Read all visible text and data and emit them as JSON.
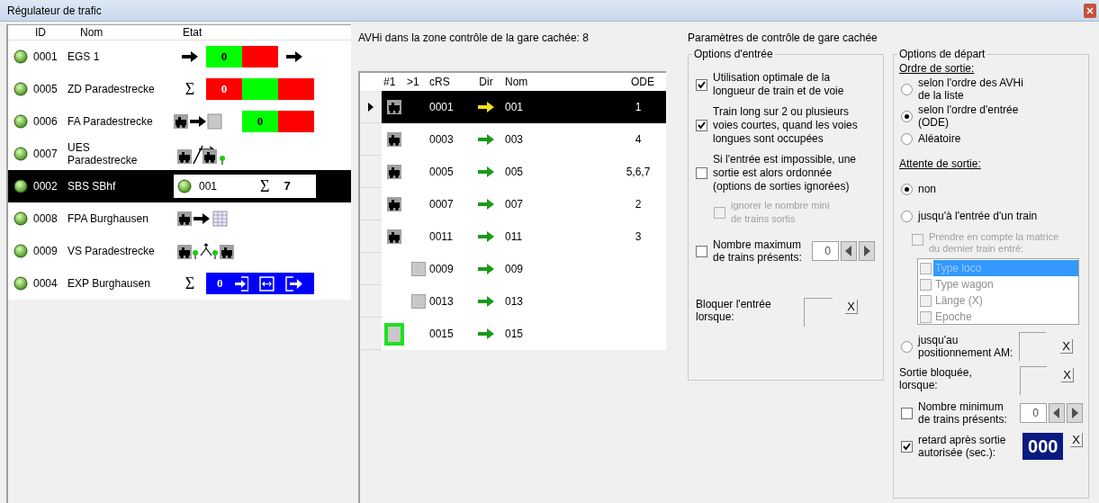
{
  "window": {
    "title": "Régulateur de trafic"
  },
  "list": {
    "columns": [
      "ID",
      "Nom",
      "Etat"
    ],
    "items": [
      {
        "id": "0001",
        "name": "EGS 1",
        "selected": false,
        "status": {
          "kind": "bar",
          "prefix": {
            "kind": "arrow"
          },
          "trail": {
            "kind": "arrow"
          },
          "segments": [
            {
              "color": "#00ff00",
              "text": "0"
            },
            {
              "color": "#ff0000"
            }
          ]
        }
      },
      {
        "id": "0005",
        "name": "ZD Paradestrecke",
        "selected": false,
        "status": {
          "kind": "bar",
          "prefix": {
            "kind": "sum",
            "symbol": "Σ"
          },
          "segments": [
            {
              "color": "#ff0000",
              "text": "0"
            },
            {
              "color": "#00ff00"
            },
            {
              "color": "#ff0000"
            }
          ]
        }
      },
      {
        "id": "0006",
        "name": "FA Paradestrecke",
        "selected": false,
        "status": {
          "kind": "bar",
          "prefix": {
            "kind": "train_to_slot"
          },
          "segments": [
            {
              "color": "#00ff00",
              "text": "0"
            },
            {
              "color": "#ff0000"
            }
          ]
        }
      },
      {
        "id": "0007",
        "name": "UES\nParadestrecke",
        "selected": false,
        "status": {
          "kind": "route"
        }
      },
      {
        "id": "0002",
        "name": "SBS SBhf",
        "selected": true,
        "status": {
          "kind": "station",
          "track": "001",
          "symbol": "Σ",
          "count": "7"
        }
      },
      {
        "id": "0008",
        "name": "FPA Burghausen",
        "selected": false,
        "status": {
          "kind": "train_to_table"
        }
      },
      {
        "id": "0009",
        "name": "VS Paradestrecke",
        "selected": false,
        "status": {
          "kind": "split"
        }
      },
      {
        "id": "0004",
        "name": "EXP Burghausen",
        "selected": false,
        "status": {
          "kind": "exit",
          "symbol": "Σ",
          "count": "0",
          "color": "#0000ff"
        }
      }
    ]
  },
  "trains": {
    "title": "AVHi dans la zone contrôle de la gare cachée: 8",
    "columns": [
      "#1",
      ">1",
      "cRS",
      "Dir",
      "Nom",
      "ODE"
    ],
    "rows": [
      {
        "crs": "0001",
        "nom": "001",
        "ode": "1",
        "selected": true,
        "marker": {
          "kind": "loco"
        }
      },
      {
        "crs": "0003",
        "nom": "003",
        "ode": "4",
        "selected": false,
        "marker": {
          "kind": "loco"
        }
      },
      {
        "crs": "0005",
        "nom": "005",
        "ode": "5,6,7",
        "selected": false,
        "marker": {
          "kind": "loco"
        }
      },
      {
        "crs": "0007",
        "nom": "007",
        "ode": "2",
        "selected": false,
        "marker": {
          "kind": "loco"
        }
      },
      {
        "crs": "0011",
        "nom": "011",
        "ode": "3",
        "selected": false,
        "marker": {
          "kind": "loco"
        }
      },
      {
        "crs": "0009",
        "nom": "009",
        "selected": false,
        "marker": {
          "kind": "slot"
        }
      },
      {
        "crs": "0013",
        "nom": "013",
        "selected": false,
        "marker": {
          "kind": "slot"
        }
      },
      {
        "crs": "0015",
        "nom": "015",
        "selected": false,
        "marker": {
          "kind": "slot_active"
        }
      }
    ]
  },
  "settings": {
    "title": "Paramètres de contrôle de gare cachée",
    "entry": {
      "title": "Options d'entrée",
      "options": [
        {
          "label": "Utilisation optimale de la\nlongueur de train et de voie",
          "checked": true,
          "disabled": false,
          "indented": false
        },
        {
          "label": "Train long sur 2 ou plusieurs\nvoies courtes, quand les voies\nlongues sont occupées",
          "checked": true,
          "disabled": false,
          "indented": false
        },
        {
          "label": "Si l'entrée est impossible, une\nsortie est alors ordonnée\n(options de sorties ignorées)",
          "checked": false,
          "disabled": false,
          "indented": false
        },
        {
          "label": "ignorer le nombre mini\nde trains sortis",
          "checked": false,
          "disabled": true,
          "indented": true
        }
      ],
      "max_trains": {
        "label": "Nombre maximum\nde trains présents:",
        "checked": false,
        "value": "0"
      },
      "block": {
        "label": "Bloquer l'entrée\nlorsque:",
        "clear": "X"
      }
    },
    "departure": {
      "title": "Options de départ",
      "order": {
        "title": "Ordre de sortie:",
        "options": [
          {
            "label": "selon l'ordre des AVHi\nde la liste",
            "selected": false
          },
          {
            "label": "selon l'ordre d'entrée\n(ODE)",
            "selected": true
          },
          {
            "label": "Aléatoire",
            "selected": false
          }
        ]
      },
      "wait": {
        "title": "Attente de sortie:",
        "options": [
          {
            "label": "non",
            "selected": true
          },
          {
            "label": "jusqu'à l'entrée d'un train",
            "selected": false
          },
          {
            "label": "jusqu'au\npositionnement AM:",
            "selected": false,
            "clear": "X"
          }
        ]
      },
      "matrix": {
        "label": "Prendre en compte la matrice\ndu dernier train entré:",
        "checked": false,
        "disabled": true,
        "items": [
          {
            "label": "Type loco",
            "checked": false,
            "selected": true
          },
          {
            "label": "Type wagon",
            "checked": false,
            "selected": false
          },
          {
            "label": "Länge (X)",
            "checked": false,
            "selected": false
          },
          {
            "label": "Epoche",
            "checked": false,
            "selected": false
          }
        ]
      },
      "blocked": {
        "label": "Sortie bloquée,\nlorsque:",
        "clear": "X"
      },
      "min_trains": {
        "label": "Nombre minimum\nde trains présents:",
        "checked": false,
        "value": "0"
      },
      "delay": {
        "label": "retard après sortie\nautorisée (sec.):",
        "checked": true,
        "value": "000",
        "clear": "X"
      }
    }
  }
}
